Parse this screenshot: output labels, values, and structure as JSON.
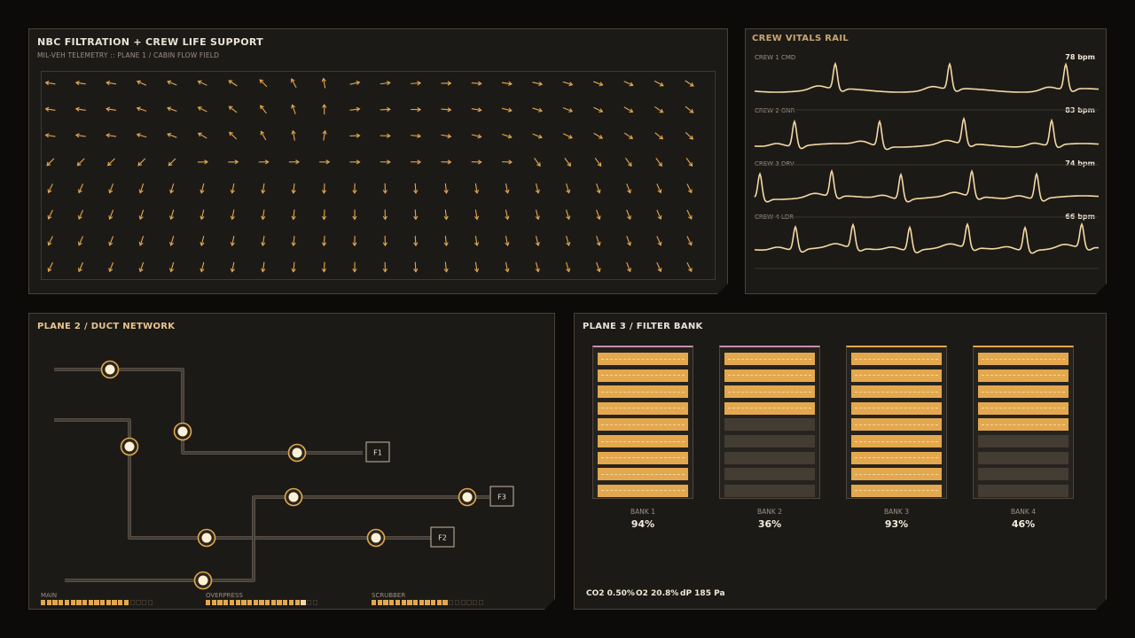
{
  "flow_panel": {
    "title": "NBC FILTRATION + CREW LIFE SUPPORT",
    "subtitle": "MIL-VEH TELEMETRY :: PLANE 1 / CABIN FLOW FIELD"
  },
  "vitals_panel": {
    "title": "CREW VITALS RAIL",
    "crew": [
      {
        "label": "CREW 1 CMD",
        "bpm": "78 bpm"
      },
      {
        "label": "CREW 2 GNR",
        "bpm": "83 bpm"
      },
      {
        "label": "CREW 3 DRV",
        "bpm": "74 bpm"
      },
      {
        "label": "CREW 4 LDR",
        "bpm": "66 bpm"
      }
    ]
  },
  "duct_panel": {
    "title": "PLANE 2 / DUCT NETWORK",
    "filters": [
      "F1",
      "F2",
      "F3"
    ],
    "meters": [
      {
        "label": "MAIN",
        "filled": 15,
        "total": 19
      },
      {
        "label": "OVERPRESS",
        "filled": 17,
        "total": 19
      },
      {
        "label": "SCRUBBER",
        "filled": 13,
        "total": 19
      }
    ]
  },
  "filter_panel": {
    "title": "PLANE 3 / FILTER BANK",
    "banks": [
      {
        "label": "BANK 1",
        "pct": "94%",
        "filled": 9,
        "total": 9
      },
      {
        "label": "BANK 2",
        "pct": "36%",
        "filled": 4,
        "total": 9
      },
      {
        "label": "BANK 3",
        "pct": "93%",
        "filled": 9,
        "total": 9
      },
      {
        "label": "BANK 4",
        "pct": "46%",
        "filled": 5,
        "total": 9
      }
    ],
    "readouts": {
      "co2": "CO2 0.50%",
      "o2": "O2 20.8%",
      "dp": "dP 185 Pa"
    }
  },
  "colors": {
    "accent": "#e3a84e",
    "accent_light": "#f5d9a3",
    "panel": "#1c1a17",
    "border": "#4a4236",
    "pink_cap": "#c48fb0"
  }
}
